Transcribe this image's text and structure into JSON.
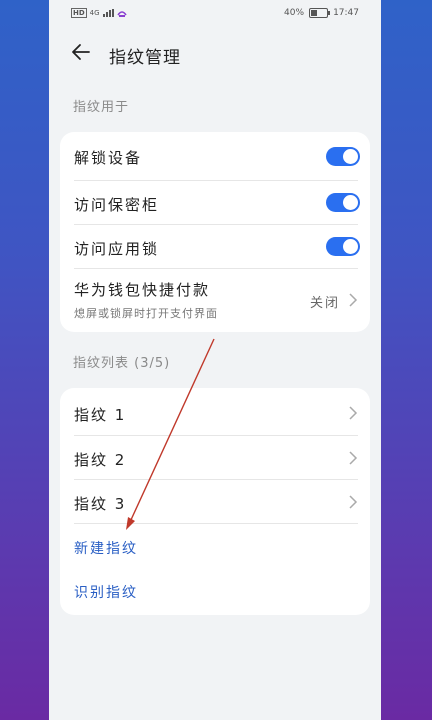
{
  "status": {
    "network": "HD",
    "signal": "4G",
    "battery": "40%",
    "time": "17:47"
  },
  "header": {
    "title": "指纹管理"
  },
  "usage_section": {
    "label": "指纹用于",
    "items": [
      {
        "label": "解锁设备",
        "enabled": true
      },
      {
        "label": "访问保密柜",
        "enabled": true
      },
      {
        "label": "访问应用锁",
        "enabled": true
      }
    ],
    "wallet": {
      "label": "华为钱包快捷付款",
      "sub": "熄屏或锁屏时打开支付界面",
      "value": "关闭"
    }
  },
  "list_section": {
    "label": "指纹列表 (3/5)",
    "items": [
      {
        "label": "指纹 1"
      },
      {
        "label": "指纹 2"
      },
      {
        "label": "指纹 3"
      }
    ],
    "new_label": "新建指纹",
    "identify_label": "识别指纹"
  },
  "colors": {
    "accent": "#2a6ff0",
    "link": "#2a5fc4",
    "annotation_arrow": "#c0392b"
  }
}
